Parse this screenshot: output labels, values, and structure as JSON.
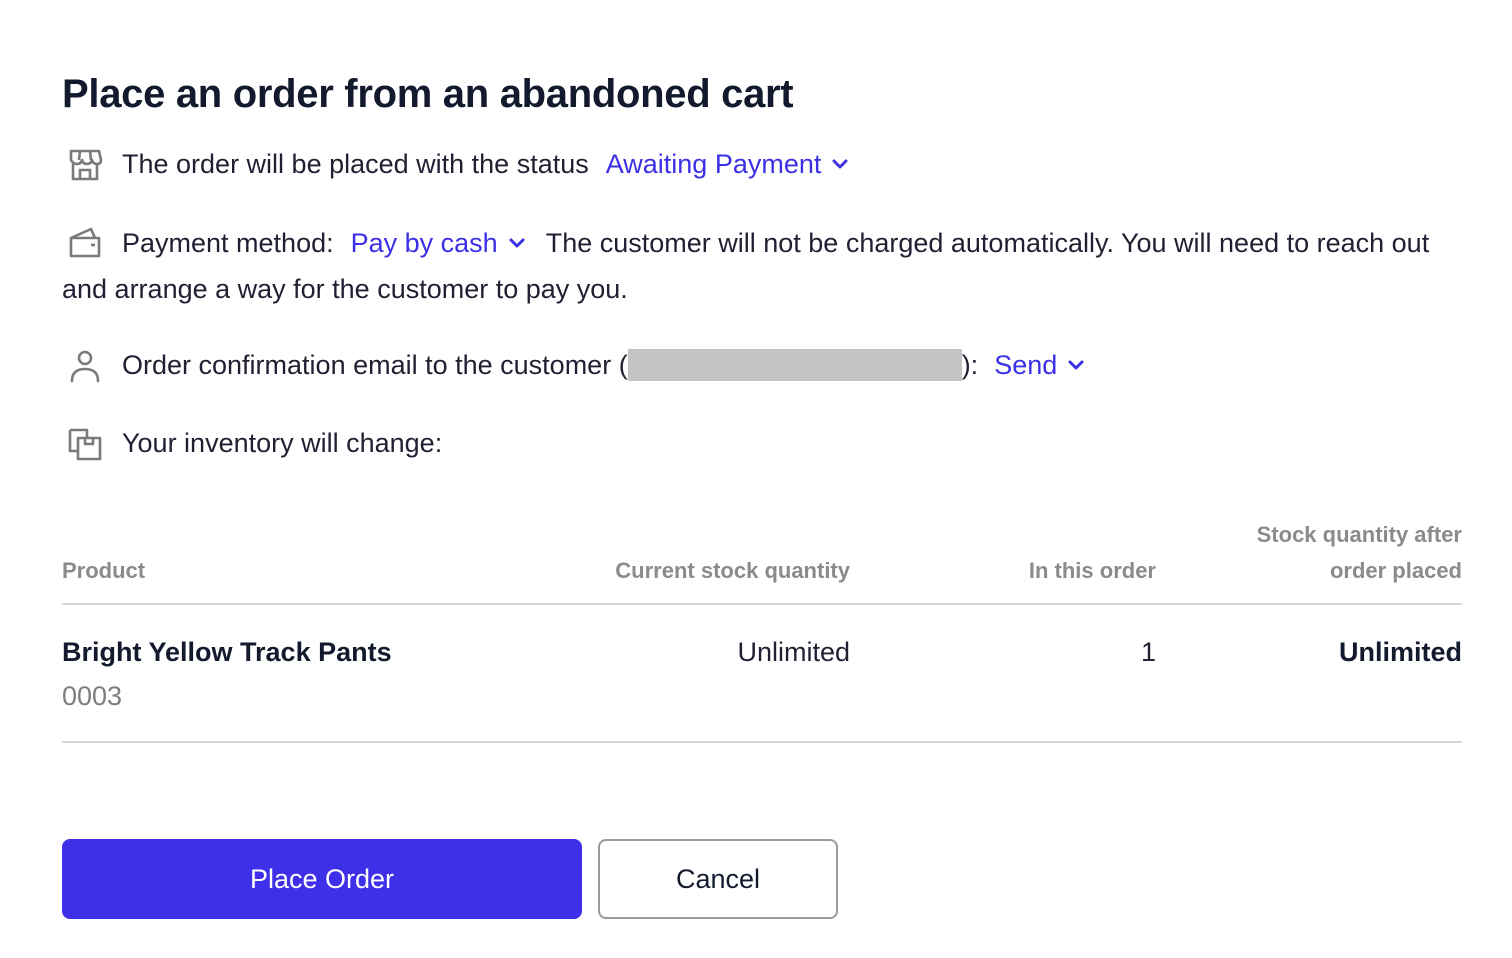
{
  "dialog": {
    "title": "Place an order from an abandoned cart"
  },
  "status_row": {
    "icon": "store-icon",
    "text": "The order will be placed with the status",
    "value": "Awaiting Payment"
  },
  "payment_row": {
    "icon": "wallet-icon",
    "label": "Payment method:",
    "value": "Pay by cash",
    "note": "The customer will not be charged automatically. You will need to reach out and arrange a way for the customer to pay you."
  },
  "email_row": {
    "icon": "user-icon",
    "text_before": "Order confirmation email to the customer (",
    "text_after": "):",
    "value": "Send"
  },
  "inventory_row": {
    "icon": "inventory-icon",
    "text": "Your inventory will change:"
  },
  "table": {
    "headers": {
      "product": "Product",
      "current_stock": "Current stock quantity",
      "in_order": "In this order",
      "after_line1": "Stock quantity after",
      "after_line2": "order placed"
    },
    "rows": [
      {
        "product": "Bright Yellow Track Pants",
        "sku": "0003",
        "current_stock": "Unlimited",
        "in_order": "1",
        "after": "Unlimited"
      }
    ]
  },
  "buttons": {
    "place_order": "Place Order",
    "cancel": "Cancel"
  },
  "colors": {
    "accent": "#3b30e6",
    "primary_button": "#3e30e8",
    "redaction": "#c4c4c4"
  }
}
